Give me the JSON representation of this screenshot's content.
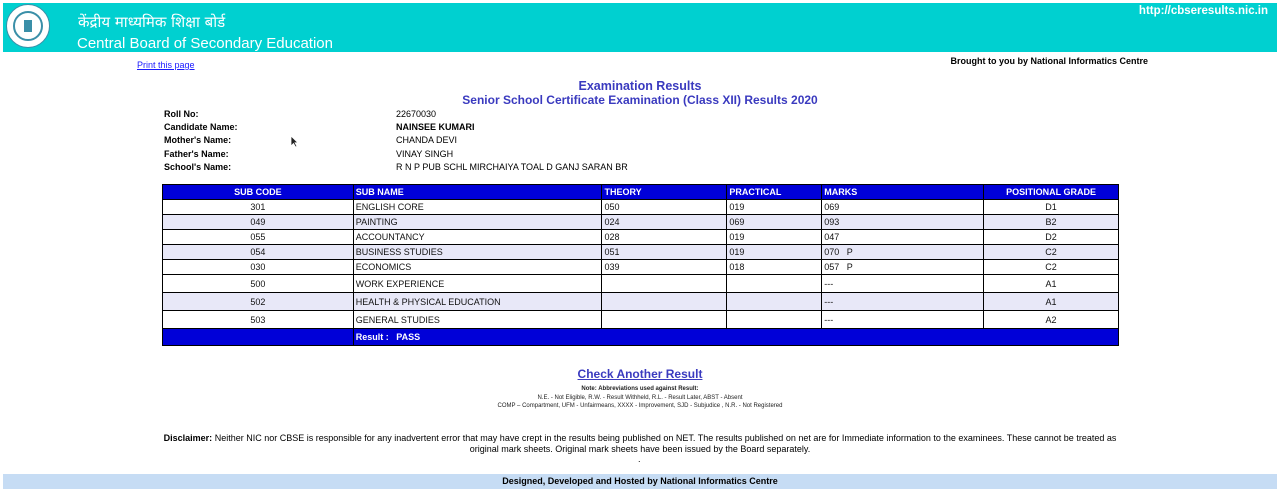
{
  "header": {
    "hindi_title": "केंद्रीय माध्यमिक शिक्षा बोर्ड",
    "english_title": "Central Board of Secondary Education",
    "url": "http://cbseresults.nic.in",
    "bg_color": "#00d0d0"
  },
  "print_link": "Print this page",
  "brought_by": "Brought to you by National Informatics Centre",
  "title1": "Examination Results",
  "title2": "Senior School Certificate Examination (Class XII) Results 2020",
  "candidate": {
    "roll_label": "Roll No:",
    "roll": "22670030",
    "name_label": "Candidate Name:",
    "name": "NAINSEE KUMARI",
    "mother_label": "Mother's Name:",
    "mother": "CHANDA DEVI",
    "father_label": "Father's Name:",
    "father": "VINAY SINGH",
    "school_label": "School's Name:",
    "school": "R N P PUB SCHL MIRCHAIYA TOAL D GANJ SARAN BR"
  },
  "table": {
    "headers": [
      "SUB CODE",
      "SUB NAME",
      "THEORY",
      "PRACTICAL",
      "MARKS",
      "POSITIONAL GRADE"
    ],
    "rows": [
      [
        "301",
        "ENGLISH CORE",
        "050",
        "019",
        "069",
        "D1"
      ],
      [
        "049",
        "PAINTING",
        "024",
        "069",
        "093",
        "B2"
      ],
      [
        "055",
        "ACCOUNTANCY",
        "028",
        "019",
        "047",
        "D2"
      ],
      [
        "054",
        "BUSINESS STUDIES",
        "051",
        "019",
        "070   P",
        "C2"
      ],
      [
        "030",
        "ECONOMICS",
        "039",
        "018",
        "057   P",
        "C2"
      ],
      [
        "500",
        "WORK EXPERIENCE",
        "",
        "",
        "---",
        "A1"
      ],
      [
        "502",
        "HEALTH & PHYSICAL EDUCATION",
        "",
        "",
        "---",
        "A1"
      ],
      [
        "503",
        "GENERAL STUDIES",
        "",
        "",
        "---",
        "A2"
      ]
    ],
    "result": "Result :   PASS",
    "header_color": "#0000d8"
  },
  "check_another": "Check Another Result",
  "note_title": "Note: Abbreviations used against Result:",
  "note_line1": "N.E. - Not Eligible, R.W. - Result Withheld, R.L. - Result Later, ABST - Absent",
  "note_line2": "COMP – Compartment, UFM - Unfairmeans, XXXX - Improvement, SJD - Subjudice , N.R. - Not Registered",
  "disclaimer_label": "Disclaimer:",
  "disclaimer_text": " Neither NIC nor CBSE is responsible for any inadvertent error that may have crept in the results being published on NET. The results published on net are for Immediate information to the examinees. These cannot be treated as original mark sheets. Original mark sheets have been issued by the Board separately.",
  "dot": ".",
  "footer": "Designed, Developed and Hosted by National Informatics Centre"
}
